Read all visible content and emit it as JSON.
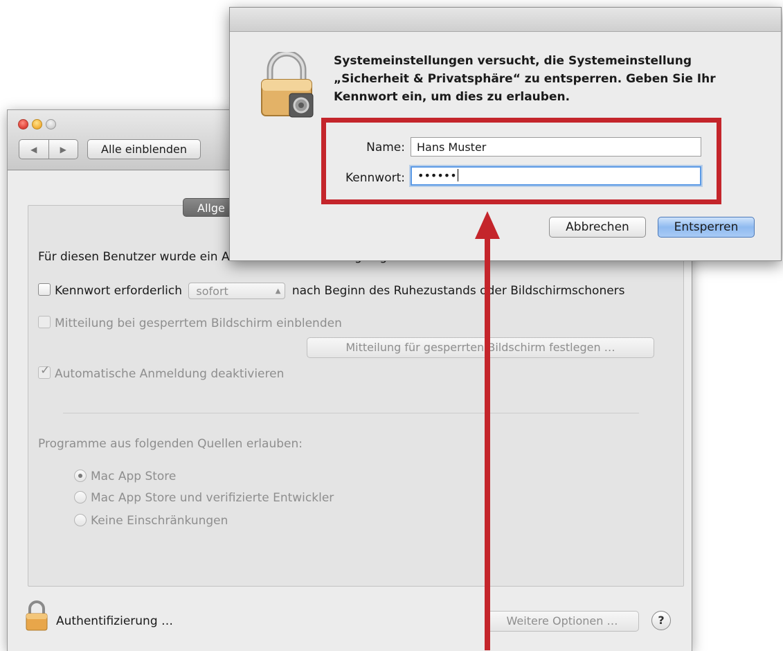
{
  "main_window": {
    "toolbar": {
      "back_glyph": "◀",
      "forward_glyph": "▶",
      "show_all_label": "Alle einblenden"
    },
    "tab_partial_label": "Allge",
    "login_password_text": "Für diesen Benutzer wurde ein Anmeldekennwort festgelegt",
    "require_password": {
      "label": "Kennwort erforderlich",
      "select_value": "sofort",
      "suffix": "nach Beginn des Ruhezustands oder Bildschirmschoners",
      "checked": false
    },
    "lock_message_checkbox": {
      "label": "Mitteilung bei gesperrtem Bildschirm einblenden",
      "checked": false
    },
    "set_lock_message_button": "Mitteilung für gesperrten Bildschirm festlegen …",
    "disable_autologin": {
      "label": "Automatische Anmeldung deaktivieren",
      "checked": true
    },
    "allow_apps_heading": "Programme aus folgenden Quellen erlauben:",
    "app_sources": [
      {
        "label": "Mac App Store",
        "selected": true
      },
      {
        "label": "Mac App Store und verifizierte Entwickler",
        "selected": false
      },
      {
        "label": "Keine Einschränkungen",
        "selected": false
      }
    ],
    "footer": {
      "auth_label": "Authentifizierung …",
      "more_options_label": "Weitere Optionen …",
      "help_label": "?"
    }
  },
  "dialog": {
    "message": "Systemeinstellungen versucht, die Systemeinstellung „Sicherheit & Privatsphäre“ zu entsperren. Geben Sie Ihr Kennwort ein, um dies zu erlauben.",
    "name_label": "Name:",
    "name_value": "Hans Muster",
    "password_label": "Kennwort:",
    "password_value": "••••••",
    "cancel_label": "Abbrechen",
    "unlock_label": "Entsperren"
  },
  "colors": {
    "highlight_red": "#c4252b",
    "focus_blue": "#5b9ae6",
    "default_button_blue": "#8fbaf0"
  }
}
